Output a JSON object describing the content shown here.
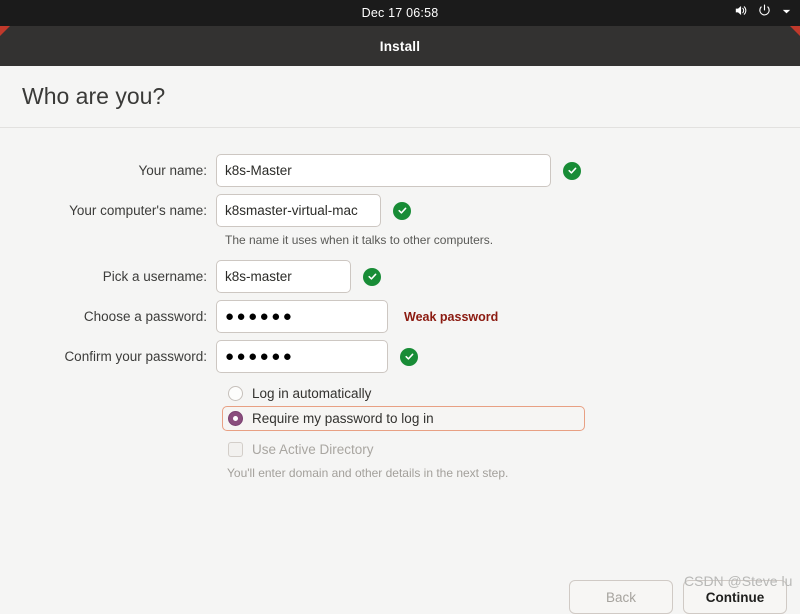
{
  "topbar": {
    "clock": "Dec 17  06:58",
    "icons": [
      "volume-icon",
      "power-icon",
      "chevron-down-icon"
    ]
  },
  "window": {
    "title": "Install",
    "accent_color": "#c0392b"
  },
  "page": {
    "title": "Who are you?"
  },
  "form": {
    "fields": [
      {
        "name": "full-name",
        "label": "Your name:",
        "value": "k8s-Master",
        "valid": true
      },
      {
        "name": "computer-name",
        "label": "Your computer's name:",
        "value": "k8smaster-virtual-mac",
        "valid": true,
        "note": "The name it uses when it talks to other computers."
      },
      {
        "name": "username",
        "label": "Pick a username:",
        "value": "k8s-master",
        "valid": true
      },
      {
        "name": "password",
        "label": "Choose a password:",
        "value": "●●●●●●",
        "strength": "Weak password",
        "strength_color": "#8b1a10"
      },
      {
        "name": "confirm-password",
        "label": "Confirm your password:",
        "value": "●●●●●●",
        "valid": true
      }
    ]
  },
  "options": {
    "login_auto": "Log in automatically",
    "login_require_password": "Require my password to log in",
    "active_directory": "Use Active Directory",
    "active_directory_note": "You'll enter domain and other details in the next step.",
    "selected": "Require my password to log in",
    "focus_ring_color": "#e8a083",
    "radio_fill_color": "#8a4d7d"
  },
  "footer": {
    "back_label": "Back",
    "continue_label": "Continue"
  },
  "watermark": {
    "text": "CSDN @Steve lu"
  }
}
